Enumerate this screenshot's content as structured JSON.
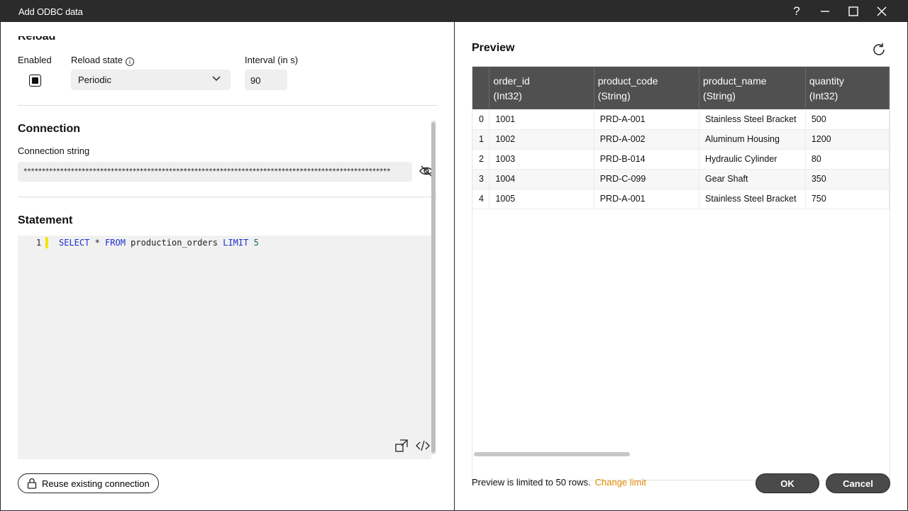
{
  "window": {
    "title": "Add ODBC data",
    "help_icon": "question-icon",
    "minimize_icon": "minimize-icon",
    "maximize_icon": "maximize-icon",
    "close_icon": "close-icon"
  },
  "reload": {
    "heading": "Reload",
    "enabled_label": "Enabled",
    "enabled_checked": true,
    "state_label": "Reload state",
    "state_value": "Periodic",
    "interval_label": "Interval (in s)",
    "interval_value": "90"
  },
  "connection": {
    "heading": "Connection",
    "string_label": "Connection string",
    "string_value": "*****************************************************************************************************",
    "visibility_icon": "eye-slash-icon"
  },
  "statement": {
    "heading": "Statement",
    "line_number": "1",
    "code": {
      "kw1": "SELECT",
      "star": " * ",
      "kw2": "FROM",
      "table": " production_orders ",
      "kw3": "LIMIT",
      "space": " ",
      "limit": "5"
    }
  },
  "reuse_button": "Reuse existing connection",
  "preview": {
    "heading": "Preview",
    "columns": [
      {
        "name": "order_id",
        "type": "(Int32)"
      },
      {
        "name": "product_code",
        "type": "(String)"
      },
      {
        "name": "product_name",
        "type": "(String)"
      },
      {
        "name": "quantity",
        "type": "(Int32)"
      }
    ],
    "rows": [
      {
        "idx": "0",
        "order_id": "1001",
        "product_code": "PRD-A-001",
        "product_name": "Stainless Steel Bracket",
        "quantity": "500"
      },
      {
        "idx": "1",
        "order_id": "1002",
        "product_code": "PRD-A-002",
        "product_name": "Aluminum Housing",
        "quantity": "1200"
      },
      {
        "idx": "2",
        "order_id": "1003",
        "product_code": "PRD-B-014",
        "product_name": "Hydraulic Cylinder",
        "quantity": "80"
      },
      {
        "idx": "3",
        "order_id": "1004",
        "product_code": "PRD-C-099",
        "product_name": "Gear Shaft",
        "quantity": "350"
      },
      {
        "idx": "4",
        "order_id": "1005",
        "product_code": "PRD-A-001",
        "product_name": "Stainless Steel Bracket",
        "quantity": "750"
      }
    ],
    "limit_note": "Preview is limited to 50 rows.",
    "change_limit": "Change limit"
  },
  "buttons": {
    "ok": "OK",
    "cancel": "Cancel"
  },
  "colors": {
    "titlebar": "#2b2b2b",
    "table_header": "#505050",
    "accent_link": "#e08a00",
    "keyword": "#1f2fd0"
  }
}
